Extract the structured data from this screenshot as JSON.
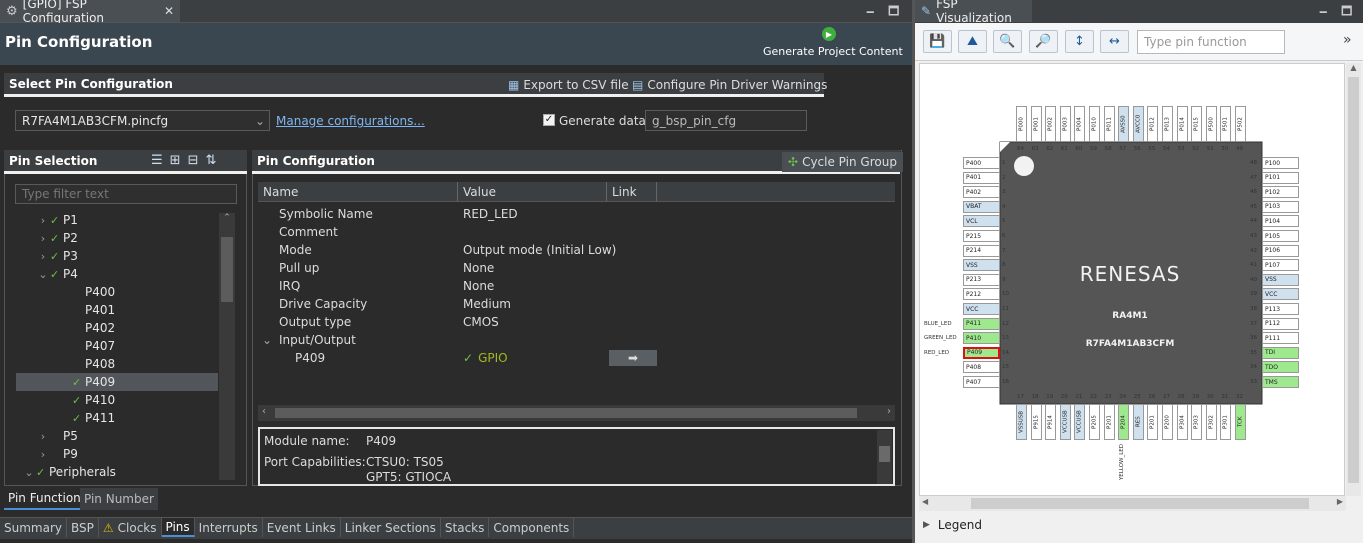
{
  "editor": {
    "tab_title": "[GPIO] FSP Configuration",
    "header_title": "Pin Configuration",
    "generate_label": "Generate Project Content",
    "select_section": "Select Pin Configuration",
    "export_csv": "Export to CSV file",
    "configure_warnings": "Configure Pin Driver Warnings",
    "pincfg_file": "R7FA4M1AB3CFM.pincfg",
    "manage_link": "Manage configurations...",
    "generate_data_label": "Generate data:",
    "generate_data_value": "g_bsp_pin_cfg",
    "pin_selection_title": "Pin Selection",
    "filter_placeholder": "Type filter text",
    "tree": [
      {
        "label": "P1",
        "level": 1,
        "checked": true,
        "chev": "›"
      },
      {
        "label": "P2",
        "level": 1,
        "checked": true,
        "chev": "›"
      },
      {
        "label": "P3",
        "level": 1,
        "checked": true,
        "chev": "›"
      },
      {
        "label": "P4",
        "level": 1,
        "checked": true,
        "chev": "⌄"
      },
      {
        "label": "P400",
        "level": 2,
        "checked": false
      },
      {
        "label": "P401",
        "level": 2,
        "checked": false
      },
      {
        "label": "P402",
        "level": 2,
        "checked": false
      },
      {
        "label": "P407",
        "level": 2,
        "checked": false
      },
      {
        "label": "P408",
        "level": 2,
        "checked": false
      },
      {
        "label": "P409",
        "level": 2,
        "checked": true,
        "selected": true
      },
      {
        "label": "P410",
        "level": 2,
        "checked": true
      },
      {
        "label": "P411",
        "level": 2,
        "checked": true
      },
      {
        "label": "P5",
        "level": 1,
        "checked": false,
        "chev": "›"
      },
      {
        "label": "P9",
        "level": 1,
        "checked": false,
        "chev": "›"
      },
      {
        "label": "Peripherals",
        "level": 0,
        "checked": true,
        "chev": "⌄"
      }
    ],
    "pin_config_title": "Pin Configuration",
    "cycle_pin_group": "Cycle Pin Group",
    "col_name": "Name",
    "col_value": "Value",
    "col_link": "Link",
    "props": [
      {
        "name": "Symbolic Name",
        "value": "RED_LED"
      },
      {
        "name": "Comment",
        "value": ""
      },
      {
        "name": "Mode",
        "value": "Output mode (Initial Low)"
      },
      {
        "name": "Pull up",
        "value": "None"
      },
      {
        "name": "IRQ",
        "value": "None"
      },
      {
        "name": "Drive Capacity",
        "value": "Medium"
      },
      {
        "name": "Output type",
        "value": "CMOS"
      }
    ],
    "io_group": "Input/Output",
    "io_pin": "P409",
    "io_value": "GPIO",
    "module_name_label": "Module name:",
    "module_name_value": "P409",
    "port_cap_label": "Port Capabilities:",
    "port_cap_1": "CTSU0: TS05",
    "port_cap_2": "GPT5: GTIOCA",
    "subtab_pin_function": "Pin Function",
    "subtab_pin_number": "Pin Number",
    "bottom_tabs": [
      "Summary",
      "BSP",
      "Clocks",
      "Pins",
      "Interrupts",
      "Event Links",
      "Linker Sections",
      "Stacks",
      "Components"
    ]
  },
  "viz": {
    "tab_title": "FSP Visualization",
    "search_placeholder": "Type pin function",
    "legend": "Legend",
    "brand": "RENESAS",
    "chip_family": "RA4M1",
    "chip_part": "R7FA4M1AB3CFM",
    "left_pins": [
      {
        "n": "1",
        "label": "P400",
        "t": "w"
      },
      {
        "n": "2",
        "label": "P401",
        "t": "w"
      },
      {
        "n": "3",
        "label": "P402",
        "t": "w"
      },
      {
        "n": "4",
        "label": "VBAT",
        "t": "b"
      },
      {
        "n": "5",
        "label": "VCL",
        "t": "b"
      },
      {
        "n": "6",
        "label": "P215",
        "t": "w"
      },
      {
        "n": "7",
        "label": "P214",
        "t": "w"
      },
      {
        "n": "8",
        "label": "VSS",
        "t": "b"
      },
      {
        "n": "9",
        "label": "P213",
        "t": "w"
      },
      {
        "n": "10",
        "label": "P212",
        "t": "w"
      },
      {
        "n": "11",
        "label": "VCC",
        "t": "b"
      },
      {
        "n": "12",
        "label": "P411",
        "t": "g",
        "ext": "BLUE_LED"
      },
      {
        "n": "13",
        "label": "P410",
        "t": "g",
        "ext": "GREEN_LED"
      },
      {
        "n": "14",
        "label": "P409",
        "t": "g",
        "ext": "RED_LED",
        "hl": true
      },
      {
        "n": "15",
        "label": "P408",
        "t": "w"
      },
      {
        "n": "16",
        "label": "P407",
        "t": "w"
      }
    ],
    "right_pins": [
      {
        "n": "48",
        "label": "P100",
        "t": "w"
      },
      {
        "n": "47",
        "label": "P101",
        "t": "w"
      },
      {
        "n": "46",
        "label": "P102",
        "t": "w"
      },
      {
        "n": "45",
        "label": "P103",
        "t": "w"
      },
      {
        "n": "44",
        "label": "P104",
        "t": "w"
      },
      {
        "n": "43",
        "label": "P105",
        "t": "w"
      },
      {
        "n": "42",
        "label": "P106",
        "t": "w"
      },
      {
        "n": "41",
        "label": "P107",
        "t": "w"
      },
      {
        "n": "40",
        "label": "VSS",
        "t": "b"
      },
      {
        "n": "39",
        "label": "VCC",
        "t": "b"
      },
      {
        "n": "38",
        "label": "P113",
        "t": "w"
      },
      {
        "n": "37",
        "label": "P112",
        "t": "w"
      },
      {
        "n": "36",
        "label": "P111",
        "t": "w"
      },
      {
        "n": "35",
        "label": "TDI",
        "t": "g"
      },
      {
        "n": "34",
        "label": "TDO",
        "t": "g"
      },
      {
        "n": "33",
        "label": "TMS",
        "t": "g"
      }
    ],
    "top_pins": [
      {
        "n": "64",
        "label": "P000",
        "t": "w"
      },
      {
        "n": "63",
        "label": "P001",
        "t": "w"
      },
      {
        "n": "62",
        "label": "P002",
        "t": "w"
      },
      {
        "n": "61",
        "label": "P003",
        "t": "w"
      },
      {
        "n": "60",
        "label": "P004",
        "t": "w"
      },
      {
        "n": "59",
        "label": "P010",
        "t": "w"
      },
      {
        "n": "58",
        "label": "P011",
        "t": "w"
      },
      {
        "n": "57",
        "label": "AVSS0",
        "t": "b"
      },
      {
        "n": "56",
        "label": "AVCC0",
        "t": "b"
      },
      {
        "n": "55",
        "label": "P012",
        "t": "w"
      },
      {
        "n": "54",
        "label": "P013",
        "t": "w"
      },
      {
        "n": "53",
        "label": "P014",
        "t": "w"
      },
      {
        "n": "52",
        "label": "P015",
        "t": "w"
      },
      {
        "n": "51",
        "label": "P500",
        "t": "w"
      },
      {
        "n": "50",
        "label": "P501",
        "t": "w"
      },
      {
        "n": "49",
        "label": "P502",
        "t": "w"
      }
    ],
    "bottom_pins": [
      {
        "n": "17",
        "label": "VSSUSB",
        "t": "b"
      },
      {
        "n": "18",
        "label": "P915",
        "t": "w"
      },
      {
        "n": "19",
        "label": "P914",
        "t": "w"
      },
      {
        "n": "20",
        "label": "VCCUSB",
        "t": "b"
      },
      {
        "n": "21",
        "label": "VCCUSB",
        "t": "b"
      },
      {
        "n": "22",
        "label": "P205",
        "t": "w"
      },
      {
        "n": "23",
        "label": "P201",
        "t": "w"
      },
      {
        "n": "24",
        "label": "P204",
        "t": "g",
        "ext": "YELLOW_LED"
      },
      {
        "n": "25",
        "label": "RES",
        "t": "b"
      },
      {
        "n": "26",
        "label": "P201",
        "t": "w"
      },
      {
        "n": "27",
        "label": "P200",
        "t": "w"
      },
      {
        "n": "28",
        "label": "P304",
        "t": "w"
      },
      {
        "n": "29",
        "label": "P303",
        "t": "w"
      },
      {
        "n": "30",
        "label": "P302",
        "t": "w"
      },
      {
        "n": "31",
        "label": "P301",
        "t": "w"
      },
      {
        "n": "32",
        "label": "TCK",
        "t": "g"
      }
    ]
  }
}
